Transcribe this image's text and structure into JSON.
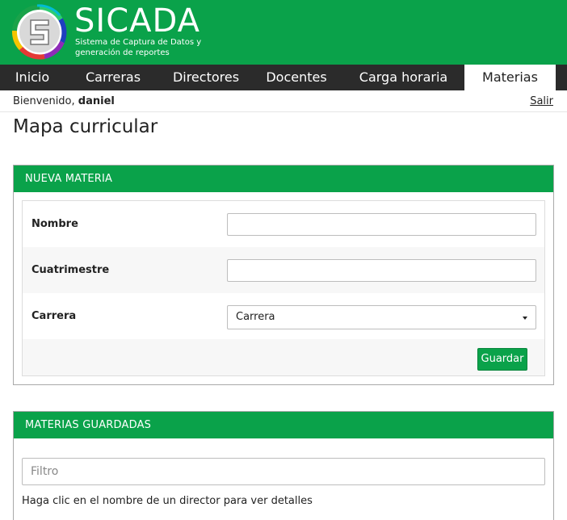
{
  "app": {
    "name": "SICADA",
    "tagline_line1": "Sistema de Captura de Datos y",
    "tagline_line2": "generación de reportes",
    "logo_icon": "sicada-logo-icon"
  },
  "nav": {
    "items": [
      {
        "label": "Inicio"
      },
      {
        "label": "Carreras"
      },
      {
        "label": "Directores"
      },
      {
        "label": "Docentes"
      },
      {
        "label": "Carga horaria"
      },
      {
        "label": "Materias",
        "active": true
      }
    ]
  },
  "user": {
    "greeting": "Bienvenido,",
    "name": "daniel",
    "logout_label": "Salir"
  },
  "page": {
    "title": "Mapa curricular"
  },
  "new_subject": {
    "heading": "NUEVA MATERIA",
    "fields": {
      "nombre_label": "Nombre",
      "nombre_value": "",
      "cuatrimestre_label": "Cuatrimestre",
      "cuatrimestre_value": "",
      "carrera_label": "Carrera",
      "carrera_selected": "Carrera"
    },
    "save_label": "Guardar"
  },
  "saved_subjects": {
    "heading": "MATERIAS GUARDADAS",
    "filter_placeholder": "Filtro",
    "hint": "Haga clic en el nombre de un director para ver detalles"
  },
  "colors": {
    "brand_green": "#0aa24a",
    "nav_dark": "#2b2b2b"
  }
}
